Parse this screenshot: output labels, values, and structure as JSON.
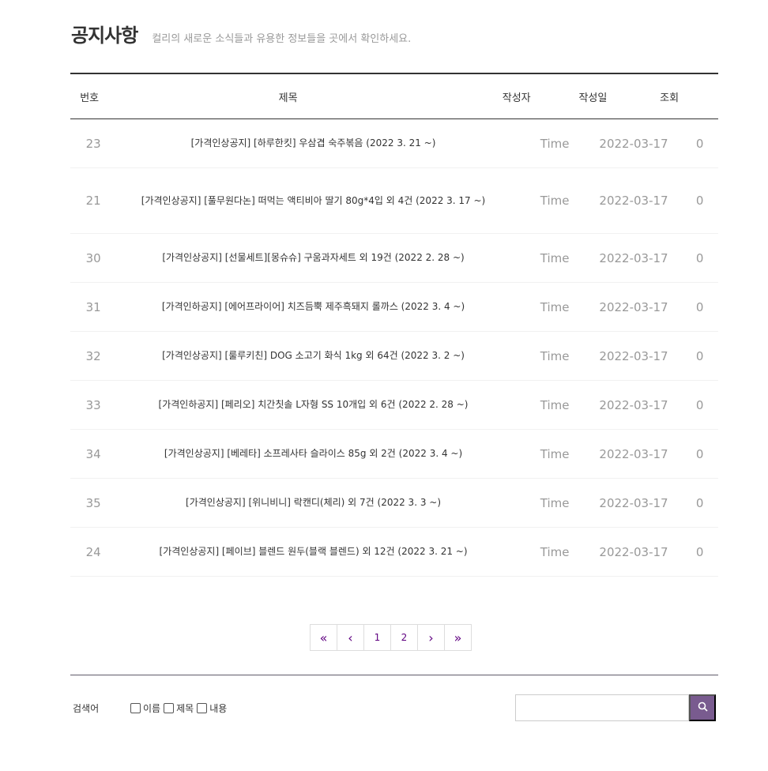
{
  "header": {
    "title": "공지사항",
    "subtitle": "컬리의 새로운 소식들과 유용한 정보들을 곳에서 확인하세요."
  },
  "table": {
    "columns": {
      "no": "번호",
      "title": "제목",
      "writer": "작성자",
      "date": "작성일",
      "views": "조회"
    },
    "rows": [
      {
        "no": "23",
        "title": "[가격인상공지] [하루한킷] 우삼겹 숙주볶음 (2022 3. 21 ~)",
        "writer": "Time",
        "date": "2022-03-17",
        "views": "0"
      },
      {
        "no": "21",
        "title": "[가격인상공지] [풀무원다논] 떠먹는 액티비아 딸기 80g*4입 외 4건 (2022 3. 17 ~)",
        "writer": "Time",
        "date": "2022-03-17",
        "views": "0"
      },
      {
        "no": "30",
        "title": "[가격인상공지] [선물세트][몽슈슈] 구움과자세트 외 19건 (2022 2. 28 ~)",
        "writer": "Time",
        "date": "2022-03-17",
        "views": "0"
      },
      {
        "no": "31",
        "title": "[가격인하공지] [에어프라이어] 치즈듬뿍 제주흑돼지 롤까스 (2022 3. 4 ~)",
        "writer": "Time",
        "date": "2022-03-17",
        "views": "0"
      },
      {
        "no": "32",
        "title": "[가격인상공지] [룰루키친] DOG 소고기 화식 1kg 외 64건 (2022 3. 2 ~)",
        "writer": "Time",
        "date": "2022-03-17",
        "views": "0"
      },
      {
        "no": "33",
        "title": "[가격인하공지] [페리오] 치간칫솔 L자형 SS 10개입 외 6건 (2022 2. 28 ~)",
        "writer": "Time",
        "date": "2022-03-17",
        "views": "0"
      },
      {
        "no": "34",
        "title": "[가격인상공지] [베레타] 소프레사타 슬라이스 85g 외 2건 (2022 3. 4 ~)",
        "writer": "Time",
        "date": "2022-03-17",
        "views": "0"
      },
      {
        "no": "35",
        "title": "[가격인상공지] [위니비니] 락캔디(체리) 외 7건 (2022 3. 3 ~)",
        "writer": "Time",
        "date": "2022-03-17",
        "views": "0"
      },
      {
        "no": "24",
        "title": "[가격인상공지] [페이브] 블렌드 원두(블랙 블렌드) 외 12건 (2022 3. 21 ~)",
        "writer": "Time",
        "date": "2022-03-17",
        "views": "0"
      }
    ]
  },
  "pagination": {
    "first": "«",
    "prev": "‹",
    "pages": [
      "1",
      "2"
    ],
    "next": "›",
    "last": "»"
  },
  "search": {
    "label": "검색어",
    "options": [
      "이름",
      "제목",
      "내용"
    ],
    "value": "",
    "button_icon": "search-icon"
  },
  "colors": {
    "accent": "#5f0080",
    "search_button": "#795b8f"
  }
}
